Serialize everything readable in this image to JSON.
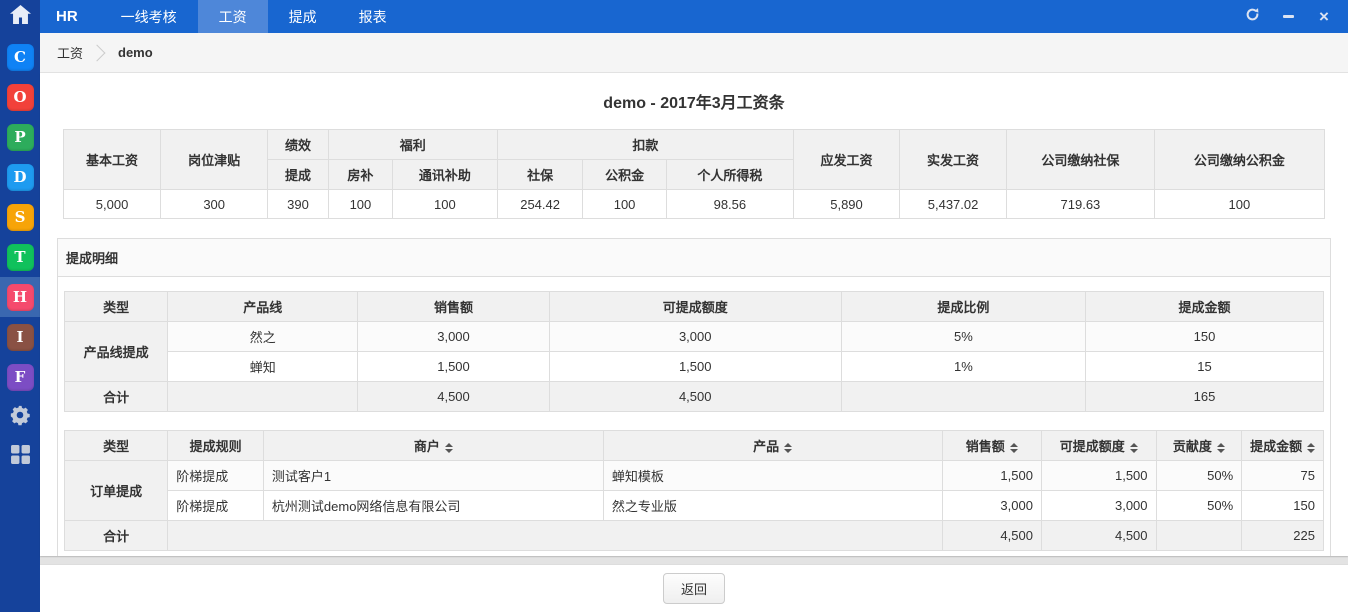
{
  "nav": {
    "brand": "HR",
    "tabs": [
      {
        "label": "一线考核",
        "active": false
      },
      {
        "label": "工资",
        "active": true
      },
      {
        "label": "提成",
        "active": false
      },
      {
        "label": "报表",
        "active": false
      }
    ]
  },
  "sidebar": {
    "apps": [
      {
        "letter": "C",
        "color": "#0f82f5",
        "active": false
      },
      {
        "letter": "O",
        "color": "#f2413a",
        "active": false
      },
      {
        "letter": "P",
        "color": "#2dac5c",
        "active": false
      },
      {
        "letter": "D",
        "color": "#1e9bf0",
        "active": false
      },
      {
        "letter": "S",
        "color": "#f7a408",
        "active": false
      },
      {
        "letter": "T",
        "color": "#10c15c",
        "active": false
      },
      {
        "letter": "H",
        "color": "#f54a6d",
        "active": true
      },
      {
        "letter": "I",
        "color": "#8a5144",
        "active": false
      },
      {
        "letter": "F",
        "color": "#7c4dc4",
        "active": false
      }
    ]
  },
  "breadcrumb": {
    "section": "工资",
    "current": "demo"
  },
  "salary": {
    "title": "demo - 2017年3月工资条",
    "headers": {
      "basic": "基本工资",
      "allowance": "岗位津贴",
      "performance": "绩效",
      "commission": "提成",
      "welfare": "福利",
      "housing": "房补",
      "telecom": "通讯补助",
      "deduction": "扣款",
      "social": "社保",
      "fund": "公积金",
      "tax": "个人所得税",
      "gross": "应发工资",
      "net": "实发工资",
      "company_social": "公司缴纳社保",
      "company_fund": "公司缴纳公积金"
    },
    "values": [
      "5,000",
      "300",
      "390",
      "100",
      "100",
      "254.42",
      "100",
      "98.56",
      "5,890",
      "5,437.02",
      "719.63",
      "100"
    ]
  },
  "commission": {
    "panel_title": "提成明细",
    "product_table": {
      "headers": [
        "类型",
        "产品线",
        "销售额",
        "可提成额度",
        "提成比例",
        "提成金额"
      ],
      "row_group_label": "产品线提成",
      "rows": [
        [
          "然之",
          "3,000",
          "3,000",
          "5%",
          "150"
        ],
        [
          "蝉知",
          "1,500",
          "1,500",
          "1%",
          "15"
        ]
      ],
      "total_label": "合计",
      "totals": {
        "sales": "4,500",
        "quota": "4,500",
        "amount": "165"
      }
    },
    "order_table": {
      "headers": [
        "类型",
        "提成规则",
        "商户",
        "产品",
        "销售额",
        "可提成额度",
        "贡献度",
        "提成金额"
      ],
      "row_group_label": "订单提成",
      "rows": [
        [
          "阶梯提成",
          "测试客户1",
          "蝉知模板",
          "1,500",
          "1,500",
          "50%",
          "75"
        ],
        [
          "阶梯提成",
          "杭州测试demo网络信息有限公司",
          "然之专业版",
          "3,000",
          "3,000",
          "50%",
          "150"
        ]
      ],
      "total_label": "合计",
      "totals": {
        "sales": "4,500",
        "quota": "4,500",
        "amount": "225"
      }
    }
  },
  "footer": {
    "back_label": "返回"
  },
  "colors": {
    "navbar": "#1866d0",
    "navbar_active_tab": "#4e87d9",
    "sidebar": "#15429b",
    "sidebar_active_item": "#3a67b0",
    "table_header_bg": "#f1f1f1",
    "table_border": "#dddddd"
  }
}
